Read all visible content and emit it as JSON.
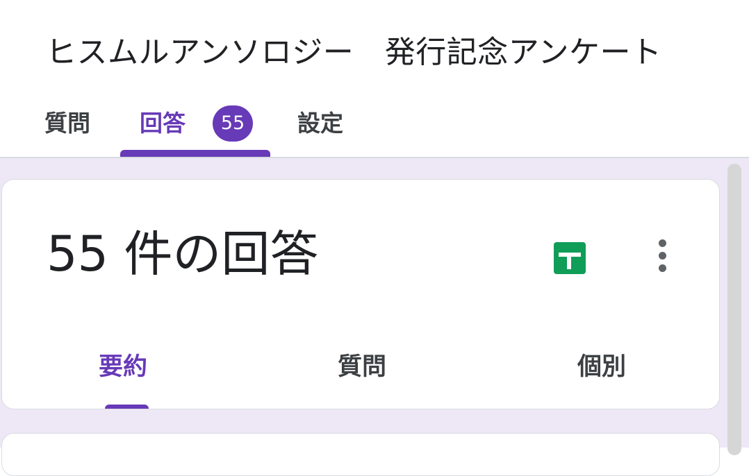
{
  "form": {
    "title": "ヒスムルアンソロジー　発行記念アンケート"
  },
  "tabs": {
    "questions": "質問",
    "responses": "回答",
    "responses_badge": "55",
    "settings": "設定"
  },
  "summary_card": {
    "response_count": "55 件の回答",
    "sheets_icon": "google-sheets-icon",
    "more_icon": "more-vert-icon",
    "subtabs": {
      "summary": "要約",
      "question": "質問",
      "individual": "個別"
    }
  },
  "colors": {
    "accent": "#673ab7",
    "background": "#ede7f6",
    "sheets_green": "#0f9d58"
  }
}
